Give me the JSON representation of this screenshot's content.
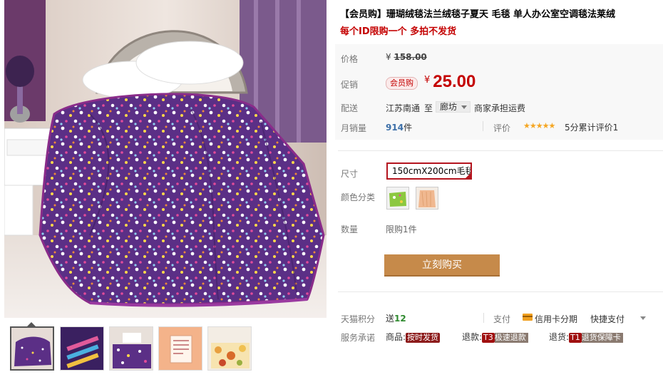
{
  "product": {
    "title": "【会员购】珊瑚绒毯法兰绒毯子夏天 毛毯 单人办公室空调毯法莱绒",
    "subtitle": "每个ID限购一个 多拍不发货"
  },
  "price": {
    "label": "价格",
    "currency": "¥",
    "original": "158.00"
  },
  "promo": {
    "label": "促销",
    "badge": "会员购",
    "currency": "¥",
    "price": "25.00"
  },
  "delivery": {
    "label": "配送",
    "from": "江苏南通",
    "to_word": "至",
    "destination": "廊坊",
    "shipping": "商家承担运费"
  },
  "sales": {
    "label": "月销量",
    "count": "914",
    "unit": "件",
    "review_label": "评价",
    "stars": "★★★★★",
    "review_text": "5分累计评价1"
  },
  "options": {
    "size_label": "尺寸",
    "size_value": "150cmX200cm毛毯",
    "color_label": "颜色分类",
    "quantity_label": "数量",
    "quantity_value": "限购1件"
  },
  "buy_button": "立刻购买",
  "footer": {
    "points_label": "天猫积分",
    "points_prefix": "送",
    "points_value": "12",
    "pay_label": "支付",
    "pay_card": "信用卡分期",
    "pay_fast": "快捷支付",
    "service_label": "服务承诺",
    "svc1_prefix": "商品:",
    "svc1_tag": "按时发货",
    "svc2_prefix": "退款:",
    "svc2_code": "T3",
    "svc2_tag": "极速退款",
    "svc3_prefix": "退货:",
    "svc3_code": "T1",
    "svc3_tag": "退货保障卡"
  },
  "colors": {
    "accent_red": "#c40000",
    "buy_button": "#c68a4a",
    "blanket_purple": "#5b2f86"
  },
  "icons": {
    "rating": "star-icon",
    "card": "credit-card-icon",
    "dropdown": "chevron-down-icon"
  }
}
